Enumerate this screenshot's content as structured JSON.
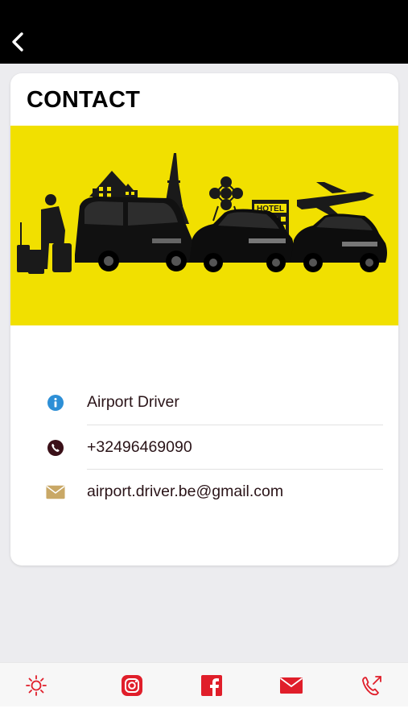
{
  "header": {
    "back_icon": "chevron-left-icon"
  },
  "card": {
    "title": "CONTACT",
    "banner_sign": "HOTEL",
    "banner_accent": "#f1e000"
  },
  "contact_rows": [
    {
      "icon": "info-icon",
      "text": "Airport Driver",
      "icon_color": "#2d8fd6"
    },
    {
      "icon": "phone-icon",
      "text": "+32496469090",
      "icon_color": "#3a1018"
    },
    {
      "icon": "mail-icon",
      "text": "airport.driver.be@gmail.com",
      "icon_color": "#c9a866"
    }
  ],
  "tabbar": {
    "accent": "#e01e2a",
    "tabs": [
      {
        "icon": "sun-icon"
      },
      {
        "icon": "instagram-icon"
      },
      {
        "icon": "facebook-icon"
      },
      {
        "icon": "mail-icon"
      },
      {
        "icon": "phone-call-icon"
      }
    ]
  }
}
